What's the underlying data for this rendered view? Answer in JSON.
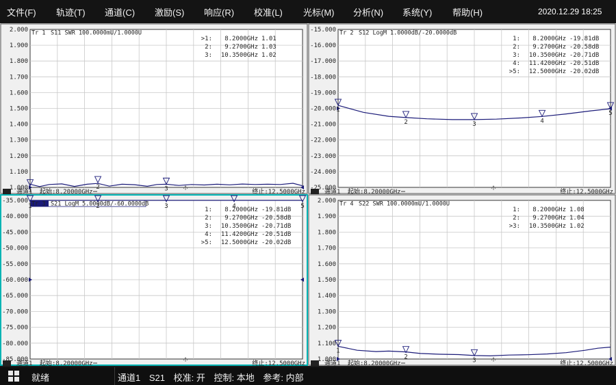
{
  "menu": [
    {
      "label": "文件(F)",
      "name": "menu-file"
    },
    {
      "label": "轨迹(T)",
      "name": "menu-trace"
    },
    {
      "label": "通道(C)",
      "name": "menu-channel"
    },
    {
      "label": "激励(S)",
      "name": "menu-stimulus"
    },
    {
      "label": "响应(R)",
      "name": "menu-response"
    },
    {
      "label": "校准(L)",
      "name": "menu-calibration"
    },
    {
      "label": "光标(M)",
      "name": "menu-marker"
    },
    {
      "label": "分析(N)",
      "name": "menu-analysis"
    },
    {
      "label": "系统(Y)",
      "name": "menu-system"
    },
    {
      "label": "帮助(H)",
      "name": "menu-help"
    }
  ],
  "clock": "2020.12.29 18:25",
  "colors": {
    "trace": "#1a1a78",
    "active_border": "#00b4b4",
    "panel_bg": "#ffffff",
    "grid": "#c8c8c8"
  },
  "chart_data": [
    {
      "type": "line",
      "title": "Tr 1  S11 SWR 100.0000mU/1.0000U",
      "tr": "Tr 1",
      "trace_spec": "S11 SWR 100.0000mU/1.0000U",
      "channel_num": "1",
      "channel_label": "通道1",
      "start_label": "起始:8.20000GHz",
      "stop_label": "终止:12.5000GHz",
      "x_range_ghz": [
        8.2,
        12.5
      ],
      "ylim": [
        1.0,
        2.0
      ],
      "y_ticks": [
        "2.000",
        "1.900",
        "1.800",
        "1.700",
        "1.600",
        "1.500",
        "1.400",
        "1.300",
        "1.200",
        "1.100",
        "1.000"
      ],
      "ref_level": 1.0,
      "series": [
        {
          "x": [
            8.2,
            8.35,
            8.5,
            8.7,
            8.9,
            9.1,
            9.27,
            9.45,
            9.65,
            9.85,
            10.05,
            10.2,
            10.35,
            10.55,
            10.75,
            10.95,
            11.15,
            11.35,
            11.55,
            11.75,
            11.95,
            12.15,
            12.35,
            12.5
          ],
          "y": [
            1.02,
            1.005,
            1.018,
            1.022,
            1.006,
            1.02,
            1.025,
            1.008,
            1.02,
            1.017,
            1.007,
            1.018,
            1.02,
            1.012,
            1.018,
            1.015,
            1.02,
            1.016,
            1.021,
            1.018,
            1.02,
            1.018,
            1.026,
            1.01
          ]
        }
      ],
      "markers": [
        {
          "n": "1",
          "active": true,
          "prefix": ">1:",
          "freq": "8.2000GHz",
          "value": "1.01",
          "x": 8.2,
          "y": 1.01
        },
        {
          "n": "2",
          "active": false,
          "prefix": "2:",
          "freq": "9.2700GHz",
          "value": "1.03",
          "x": 9.27,
          "y": 1.03
        },
        {
          "n": "3",
          "active": false,
          "prefix": "3:",
          "freq": "10.3500GHz",
          "value": "1.02",
          "x": 10.35,
          "y": 1.02
        }
      ],
      "active": false
    },
    {
      "type": "line",
      "title": "Tr 2  S12 LogM 1.0000dB/-20.0000dB",
      "tr": "Tr 2",
      "trace_spec": "S12 LogM 1.0000dB/-20.0000dB",
      "channel_num": "2",
      "channel_label": "通道1",
      "start_label": "起始:8.20000GHz",
      "stop_label": "终止:12.5000GHz",
      "x_range_ghz": [
        8.2,
        12.5
      ],
      "ylim": [
        -25.0,
        -15.0
      ],
      "y_ticks": [
        "-15.000",
        "-16.000",
        "-17.000",
        "-18.000",
        "-19.000",
        "-20.000",
        "-21.000",
        "-22.000",
        "-23.000",
        "-24.000",
        "-25.000"
      ],
      "ref_level": -20.0,
      "series": [
        {
          "x": [
            8.2,
            8.6,
            9.0,
            9.27,
            9.6,
            10.0,
            10.35,
            10.7,
            11.1,
            11.42,
            11.8,
            12.2,
            12.5
          ],
          "y": [
            -19.81,
            -20.25,
            -20.5,
            -20.58,
            -20.66,
            -20.71,
            -20.71,
            -20.68,
            -20.6,
            -20.51,
            -20.35,
            -20.15,
            -20.02
          ]
        }
      ],
      "markers": [
        {
          "n": "1",
          "active": false,
          "prefix": "1:",
          "freq": "8.2000GHz",
          "value": "-19.81dB",
          "x": 8.2,
          "y": -19.81
        },
        {
          "n": "2",
          "active": false,
          "prefix": "2:",
          "freq": "9.2700GHz",
          "value": "-20.58dB",
          "x": 9.27,
          "y": -20.58
        },
        {
          "n": "3",
          "active": false,
          "prefix": "3:",
          "freq": "10.3500GHz",
          "value": "-20.71dB",
          "x": 10.35,
          "y": -20.71
        },
        {
          "n": "4",
          "active": false,
          "prefix": "4:",
          "freq": "11.4200GHz",
          "value": "-20.51dB",
          "x": 11.42,
          "y": -20.51
        },
        {
          "n": "5",
          "active": true,
          "prefix": ">5:",
          "freq": "12.5000GHz",
          "value": "-20.02dB",
          "x": 12.5,
          "y": -20.02
        }
      ],
      "active": false
    },
    {
      "type": "line",
      "title": "Tr 3  S21 LogM 5.0000dB/-60.0000dB",
      "tr": "Tr 3",
      "trace_spec": "S21 LogM 5.0000dB/-60.0000dB",
      "channel_num": "3",
      "channel_label": "通道1",
      "start_label": "起始:8.20000GHz",
      "stop_label": "终止:12.5000GHz",
      "x_range_ghz": [
        8.2,
        12.5
      ],
      "ylim": [
        -85.0,
        -35.0
      ],
      "y_ticks": [
        "-35.000",
        "-40.000",
        "-45.000",
        "-50.000",
        "-55.000",
        "-60.000",
        "-65.000",
        "-70.000",
        "-75.000",
        "-80.000",
        "-85.000"
      ],
      "ref_level": -60.0,
      "series": [
        {
          "x": [
            8.2,
            12.5
          ],
          "y": [
            -35.0,
            -35.0
          ]
        }
      ],
      "markers": [
        {
          "n": "1",
          "active": false,
          "prefix": "1:",
          "freq": "8.2000GHz",
          "value": "-19.81dB",
          "x": 8.2,
          "y": -35.0
        },
        {
          "n": "2",
          "active": false,
          "prefix": "2:",
          "freq": "9.2700GHz",
          "value": "-20.58dB",
          "x": 9.27,
          "y": -35.0
        },
        {
          "n": "3",
          "active": false,
          "prefix": "3:",
          "freq": "10.3500GHz",
          "value": "-20.71dB",
          "x": 10.35,
          "y": -35.0
        },
        {
          "n": "4",
          "active": false,
          "prefix": "4:",
          "freq": "11.4200GHz",
          "value": "-20.51dB",
          "x": 11.42,
          "y": -35.0
        },
        {
          "n": "5",
          "active": true,
          "prefix": ">5:",
          "freq": "12.5000GHz",
          "value": "-20.02dB",
          "x": 12.5,
          "y": -35.0
        }
      ],
      "active": true
    },
    {
      "type": "line",
      "title": "Tr 4  S22 SWR 100.0000mU/1.0000U",
      "tr": "Tr 4",
      "trace_spec": "S22 SWR 100.0000mU/1.0000U",
      "channel_num": "4",
      "channel_label": "通道1",
      "start_label": "起始:8.20000GHz",
      "stop_label": "终止:12.5000GHz",
      "x_range_ghz": [
        8.2,
        12.5
      ],
      "ylim": [
        1.0,
        2.0
      ],
      "y_ticks": [
        "2.000",
        "1.900",
        "1.800",
        "1.700",
        "1.600",
        "1.500",
        "1.400",
        "1.300",
        "1.200",
        "1.100",
        "1.000"
      ],
      "ref_level": 1.0,
      "series": [
        {
          "x": [
            8.2,
            8.5,
            8.8,
            9.0,
            9.27,
            9.5,
            9.8,
            10.1,
            10.35,
            10.6,
            10.9,
            11.2,
            11.5,
            11.8,
            12.1,
            12.3,
            12.5
          ],
          "y": [
            1.08,
            1.055,
            1.047,
            1.05,
            1.045,
            1.035,
            1.03,
            1.028,
            1.022,
            1.02,
            1.025,
            1.027,
            1.032,
            1.04,
            1.055,
            1.068,
            1.075
          ]
        }
      ],
      "markers": [
        {
          "n": "1",
          "active": false,
          "prefix": "1:",
          "freq": "8.2000GHz",
          "value": "1.08",
          "x": 8.2,
          "y": 1.08
        },
        {
          "n": "2",
          "active": false,
          "prefix": "2:",
          "freq": "9.2700GHz",
          "value": "1.04",
          "x": 9.27,
          "y": 1.04
        },
        {
          "n": "3",
          "active": true,
          "prefix": ">3:",
          "freq": "10.3500GHz",
          "value": "1.02",
          "x": 10.35,
          "y": 1.02
        }
      ],
      "active": false
    }
  ],
  "status": {
    "ready": "就绪",
    "channel": "通道1",
    "param": "S21",
    "cal": "校准: 开",
    "control": "控制: 本地",
    "ref": "参考: 内部"
  }
}
